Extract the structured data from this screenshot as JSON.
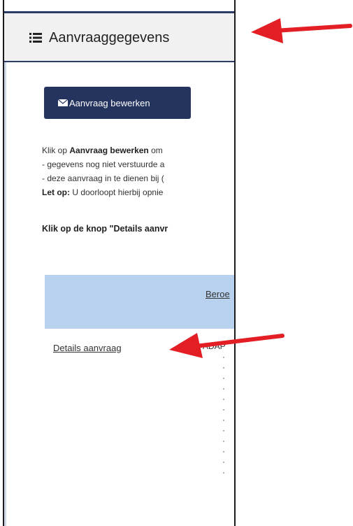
{
  "panel": {
    "title": "Aanvraaggegevens",
    "edit_button": "Aanvraag bewerken",
    "intro_prefix": "Klik op ",
    "intro_bold": "Aanvraag bewerken",
    "intro_suffix": " om",
    "line2": "- gegevens nog niet verstuurde a",
    "line3": "- deze aanvraag in te dienen bij (",
    "line4_bold": "Let op:",
    "line4_rest": " U doorloopt hierbij opnie",
    "instruction": "Klik op de knop \"Details aanvr",
    "band_link": "Beroe",
    "details_link": "Details aanvraag",
    "details_value": "ADAP"
  },
  "annotations": {
    "arrow_color": "#e31e24"
  },
  "colors": {
    "accent": "#24345e",
    "band": "#b7d1ee",
    "header_bg": "#f1f1f1"
  }
}
